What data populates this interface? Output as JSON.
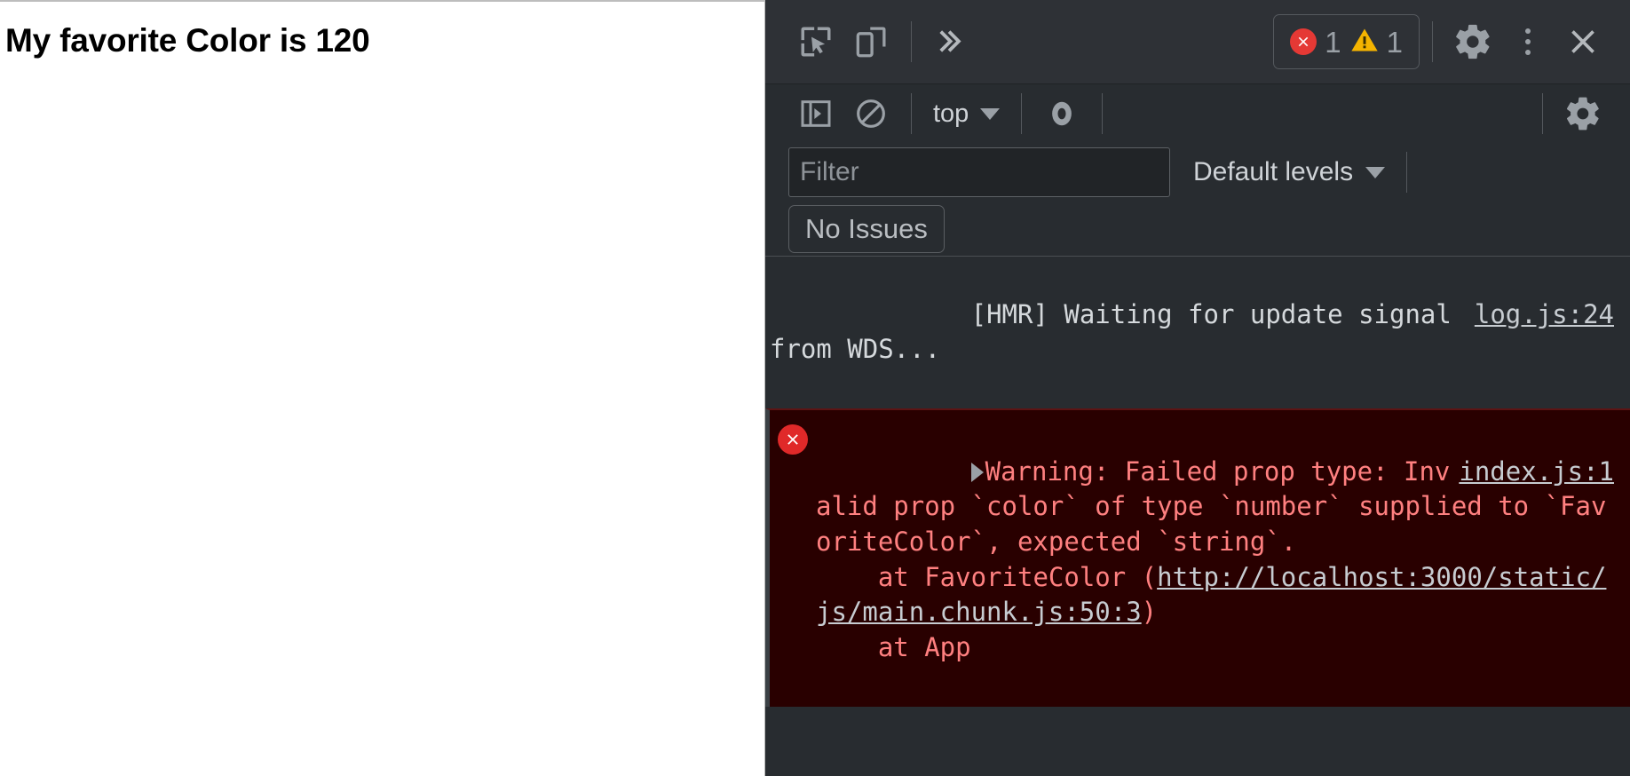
{
  "page": {
    "heading": "My favorite Color is 120"
  },
  "devtools": {
    "main_toolbar": {
      "inspect_label": "Inspect element",
      "device_label": "Toggle device toolbar",
      "more_tabs_label": "»",
      "error_count": "1",
      "warning_count": "1",
      "settings_label": "Settings",
      "more_options_label": "Customize and control DevTools",
      "close_label": "Close DevTools"
    },
    "console_toolbar": {
      "sidebar_label": "Show console sidebar",
      "clear_label": "Clear console",
      "context": "top",
      "eye_label": "Create live expression",
      "settings_label": "Console settings"
    },
    "filter_bar": {
      "filter_value": "",
      "filter_placeholder": "Filter",
      "levels": "Default levels"
    },
    "issues_bar": {
      "no_issues": "No Issues"
    },
    "messages": [
      {
        "type": "log",
        "text": "[HMR] Waiting for update signal from WDS...",
        "anchor": "log.js:24"
      },
      {
        "type": "error",
        "head": "Warning: Failed prop type: Invalid prop `color` of type `number` supplied to `FavoriteColor`, expected `string`.",
        "anchor": "index.js:1",
        "stack_prefix": "    at FavoriteColor (",
        "stack_link": "http://localhost:3000/static/js/main.chunk.js:50:3",
        "stack_suffix": ")",
        "stack_tail": "    at App"
      }
    ]
  },
  "colors": {
    "error_red": "#e02929",
    "warning_amber": "#f5b400",
    "error_bg": "#290000",
    "error_text": "#ff8080",
    "toolbar_bg": "#2e3136",
    "panel_bg": "#282c30",
    "icon_gray": "#9aa0a6"
  }
}
